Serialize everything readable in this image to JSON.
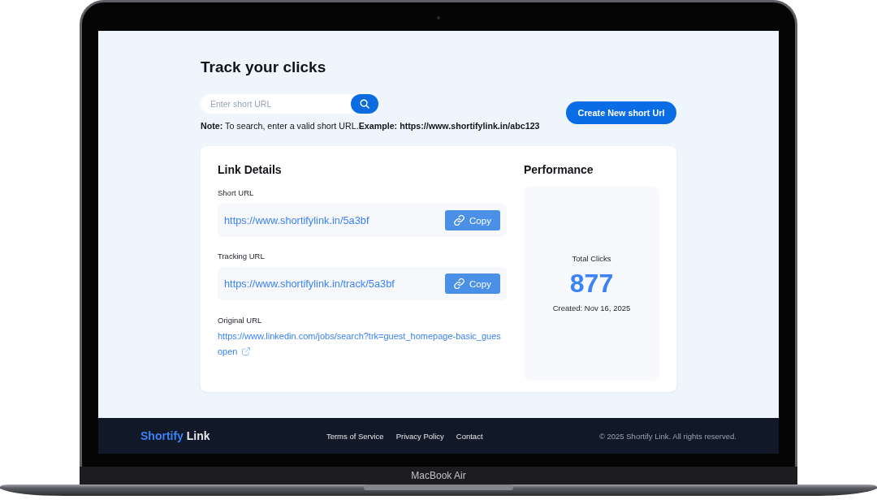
{
  "device": {
    "label": "MacBook Air"
  },
  "header": {
    "title": "Track your clicks",
    "search": {
      "placeholder": "Enter short URL"
    },
    "note": "**Note:** To search, enter a valid short URL.**Example: https://www.shortifylink.in/abc123**",
    "create_button": "Create New short Url"
  },
  "link_details": {
    "title": "Link Details",
    "fields": [
      {
        "kind": "copy",
        "label": "Short URL",
        "value": "https://www.shortifylink.in/5a3bf",
        "button": "Copy"
      },
      {
        "kind": "copy",
        "label": "Tracking URL",
        "value": "https://www.shortifylink.in/track/5a3bf",
        "button": "Copy"
      },
      {
        "kind": "link",
        "label": "Original URL",
        "value": "https://www.linkedin.com/jobs/search?trk=guest_homepage-basic_gues",
        "action": "open"
      }
    ]
  },
  "performance": {
    "title": "Performance",
    "stat_label": "Total Clicks",
    "stat_value": "877",
    "created": "Created: Nov 16, 2025"
  },
  "footer": {
    "brand": {
      "accent": "Shortify",
      "rest": "Link"
    },
    "links": [
      "Terms of Service",
      "Privacy Policy",
      "Contact"
    ],
    "copyright": "© 2025 Shortify Link. All rights reserved."
  }
}
